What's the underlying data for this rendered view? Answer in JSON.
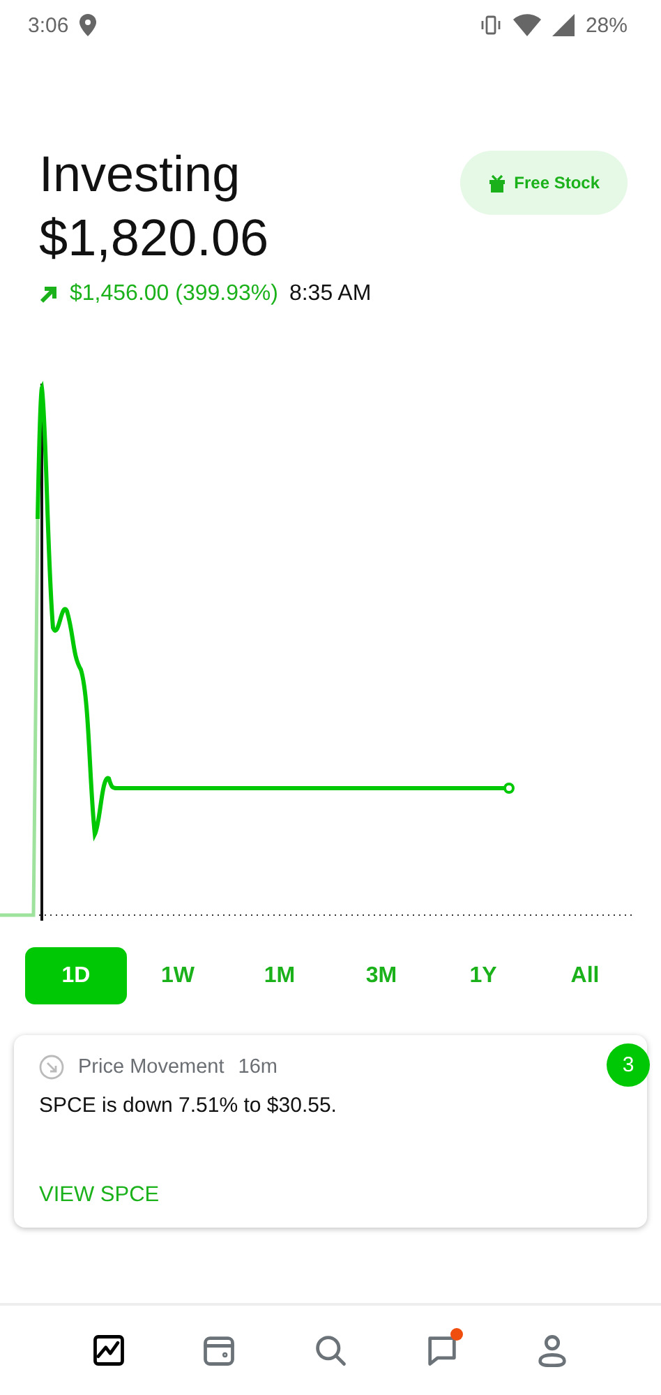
{
  "status_bar": {
    "time": "3:06",
    "battery": "28%"
  },
  "header": {
    "title": "Investing",
    "value": "$1,820.06",
    "change": "$1,456.00 (399.93%)",
    "change_time": "8:35 AM"
  },
  "free_stock_button": {
    "label": "Free Stock"
  },
  "periods": [
    {
      "label": "1D",
      "selected": true
    },
    {
      "label": "1W",
      "selected": false
    },
    {
      "label": "1M",
      "selected": false
    },
    {
      "label": "3M",
      "selected": false
    },
    {
      "label": "1Y",
      "selected": false
    },
    {
      "label": "All",
      "selected": false
    }
  ],
  "notification": {
    "category": "Price Movement",
    "age": "16m",
    "message": "SPCE is down 7.51% to $30.55.",
    "action": "VIEW SPCE",
    "count": "3"
  },
  "bottom_nav": [
    {
      "kind": "portfolio",
      "selected": true,
      "has_badge": false
    },
    {
      "kind": "wallet",
      "selected": false,
      "has_badge": false
    },
    {
      "kind": "search",
      "selected": false,
      "has_badge": false
    },
    {
      "kind": "messages",
      "selected": false,
      "has_badge": true
    },
    {
      "kind": "profile",
      "selected": false,
      "has_badge": false
    }
  ]
}
